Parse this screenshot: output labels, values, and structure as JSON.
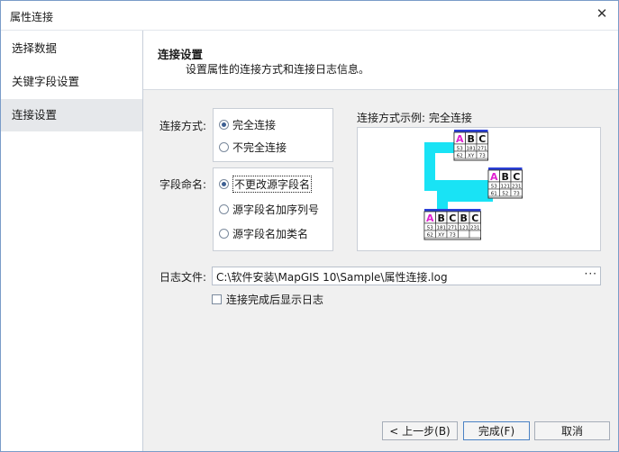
{
  "window": {
    "title": "属性连接",
    "close_symbol": "✕"
  },
  "sidebar": {
    "items": [
      {
        "label": "选择数据"
      },
      {
        "label": "关键字段设置"
      },
      {
        "label": "连接设置"
      }
    ]
  },
  "header": {
    "title": "连接设置",
    "subtitle": "设置属性的连接方式和连接日志信息。"
  },
  "join_mode": {
    "label": "连接方式:",
    "options": [
      {
        "label": "完全连接",
        "checked": true
      },
      {
        "label": "不完全连接",
        "checked": false
      }
    ]
  },
  "field_naming": {
    "label": "字段命名:",
    "options": [
      {
        "label": "不更改源字段名",
        "checked": true
      },
      {
        "label": "源字段名加序列号",
        "checked": false
      },
      {
        "label": "源字段名加类名",
        "checked": false
      }
    ]
  },
  "preview": {
    "label": "连接方式示例: 完全连接",
    "table1": {
      "header": [
        "A",
        "B",
        "C"
      ],
      "rows": [
        [
          "53",
          "181",
          "271"
        ],
        [
          "62",
          "XY",
          "73"
        ]
      ]
    },
    "table2": {
      "header": [
        "A",
        "B",
        "C"
      ],
      "rows": [
        [
          "53",
          "121",
          "231"
        ],
        [
          "61",
          "52",
          "73"
        ]
      ]
    },
    "result": {
      "header": [
        "A",
        "B",
        "C",
        "B",
        "C"
      ],
      "rows": [
        [
          "53",
          "181",
          "271",
          "121",
          "231"
        ],
        [
          "62",
          "XY",
          "73",
          "",
          ""
        ]
      ]
    }
  },
  "log": {
    "label": "日志文件:",
    "value": "C:\\软件安装\\MapGIS 10\\Sample\\属性连接.log",
    "browse": "···"
  },
  "show_log": {
    "label": "连接完成后显示日志",
    "checked": false
  },
  "buttons": {
    "back": "< 上一步(B)",
    "finish": "完成(F)",
    "cancel": "取消"
  },
  "colors": {
    "accent_blue": "#2a3fd6",
    "arrow_cyan": "#19e3f5",
    "magenta": "#e020d0"
  }
}
